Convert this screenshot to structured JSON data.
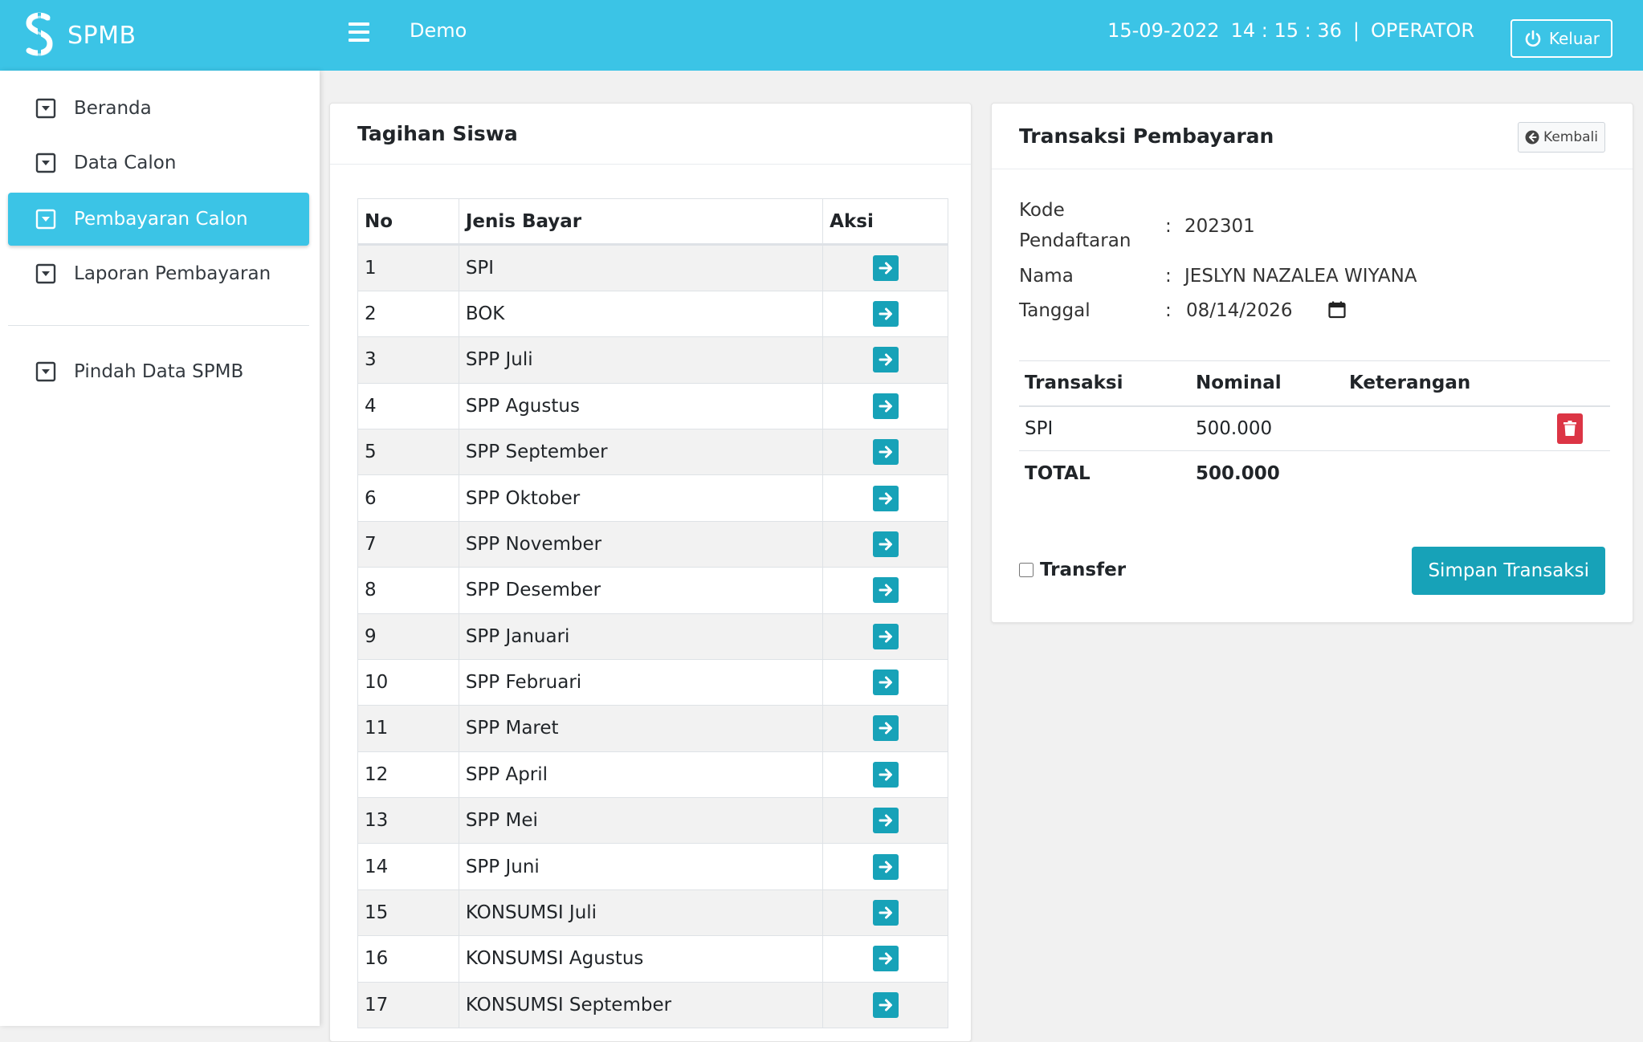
{
  "header": {
    "brand": "SPMB",
    "title": "Demo",
    "date": "15-09-2022",
    "time": "14 : 15 : 36",
    "separator": "|",
    "role": "OPERATOR",
    "logout_label": "Keluar"
  },
  "sidebar": {
    "items": [
      {
        "label": "Beranda"
      },
      {
        "label": "Data Calon"
      },
      {
        "label": "Pembayaran Calon"
      },
      {
        "label": "Laporan Pembayaran"
      },
      {
        "label": "Pindah Data SPMB"
      }
    ]
  },
  "bills": {
    "title": "Tagihan Siswa",
    "columns": {
      "no": "No",
      "jenis": "Jenis Bayar",
      "aksi": "Aksi"
    },
    "rows": [
      {
        "no": "1",
        "jenis": "SPI"
      },
      {
        "no": "2",
        "jenis": "BOK"
      },
      {
        "no": "3",
        "jenis": "SPP Juli"
      },
      {
        "no": "4",
        "jenis": "SPP Agustus"
      },
      {
        "no": "5",
        "jenis": "SPP September"
      },
      {
        "no": "6",
        "jenis": "SPP Oktober"
      },
      {
        "no": "7",
        "jenis": "SPP November"
      },
      {
        "no": "8",
        "jenis": "SPP Desember"
      },
      {
        "no": "9",
        "jenis": "SPP Januari"
      },
      {
        "no": "10",
        "jenis": "SPP Februari"
      },
      {
        "no": "11",
        "jenis": "SPP Maret"
      },
      {
        "no": "12",
        "jenis": "SPP April"
      },
      {
        "no": "13",
        "jenis": "SPP Mei"
      },
      {
        "no": "14",
        "jenis": "SPP Juni"
      },
      {
        "no": "15",
        "jenis": "KONSUMSI Juli"
      },
      {
        "no": "16",
        "jenis": "KONSUMSI Agustus"
      },
      {
        "no": "17",
        "jenis": "KONSUMSI September"
      }
    ]
  },
  "transaction": {
    "title": "Transaksi Pembayaran",
    "back_label": "Kembali",
    "kode_label": "Kode Pendaftaran",
    "kode_value": "202301",
    "nama_label": "Nama",
    "nama_value": "JESLYN NAZALEA WIYANA",
    "tanggal_label": "Tanggal",
    "tanggal_value": "08/14/2026",
    "colon": ":",
    "columns": {
      "transaksi": "Transaksi",
      "nominal": "Nominal",
      "keterangan": "Keterangan"
    },
    "items": [
      {
        "transaksi": "SPI",
        "nominal": "500.000",
        "keterangan": ""
      }
    ],
    "total_label": "TOTAL",
    "total_value": "500.000",
    "transfer_label": "Transfer",
    "save_label": "Simpan Transaksi"
  },
  "colors": {
    "accent": "#3bc4e6",
    "button": "#17a2b8",
    "danger": "#dc3545"
  }
}
